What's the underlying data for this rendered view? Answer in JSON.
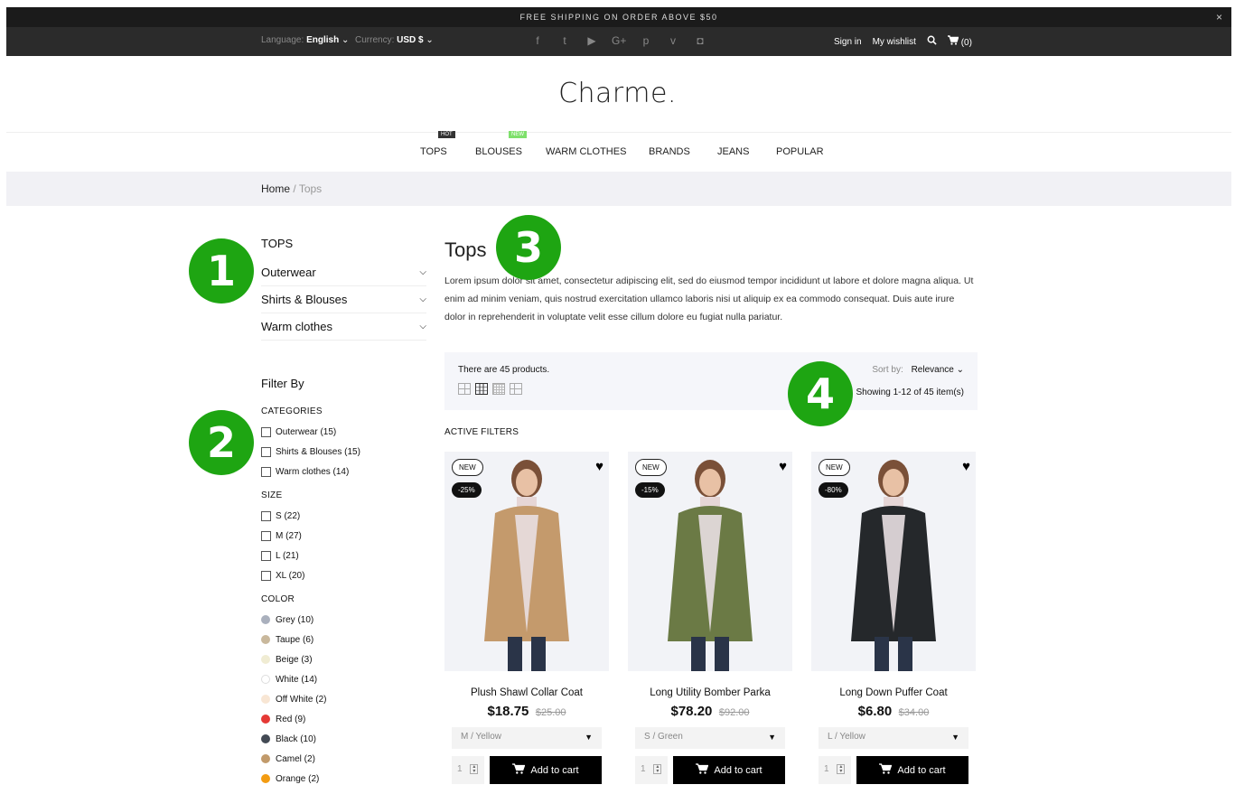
{
  "promo": {
    "text": "FREE SHIPPING ON ORDER ABOVE $50",
    "close": "×"
  },
  "topbar": {
    "language_label": "Language:",
    "language_value": "English",
    "currency_label": "Currency:",
    "currency_value": "USD $",
    "social": [
      "f",
      "t",
      "▶",
      "G+",
      "p",
      "v",
      "◘"
    ],
    "sign_in": "Sign in",
    "wishlist": "My wishlist",
    "cart_count": "(0)"
  },
  "logo": "Charme.",
  "nav": [
    {
      "label": "TOPS",
      "badge": "HOT",
      "badge_color": "#333333"
    },
    {
      "label": "BLOUSES",
      "badge": "NEW",
      "badge_color": "#7ee06b"
    },
    {
      "label": "WARM CLOTHES"
    },
    {
      "label": "BRANDS"
    },
    {
      "label": "JEANS"
    },
    {
      "label": "POPULAR"
    }
  ],
  "breadcrumb": {
    "home": "Home",
    "sep": "/",
    "current": "Tops"
  },
  "sidebar": {
    "title": "TOPS",
    "categories": [
      "Outerwear",
      "Shirts & Blouses",
      "Warm clothes"
    ],
    "filter_by": "Filter By",
    "groups": {
      "categories": {
        "title": "CATEGORIES",
        "items": [
          "Outerwear (15)",
          "Shirts & Blouses (15)",
          "Warm clothes (14)"
        ]
      },
      "size": {
        "title": "SIZE",
        "items": [
          "S (22)",
          "M (27)",
          "L (21)",
          "XL (20)"
        ]
      },
      "color": {
        "title": "COLOR",
        "items": [
          {
            "label": "Grey (10)",
            "color": "#aab0bd"
          },
          {
            "label": "Taupe (6)",
            "color": "#c9b89c"
          },
          {
            "label": "Beige (3)",
            "color": "#f0ecd3"
          },
          {
            "label": "White (14)",
            "color": "#ffffff"
          },
          {
            "label": "Off White (2)",
            "color": "#f8e6d4"
          },
          {
            "label": "Red (9)",
            "color": "#e53935"
          },
          {
            "label": "Black (10)",
            "color": "#434a54"
          },
          {
            "label": "Camel (2)",
            "color": "#c19a6b"
          },
          {
            "label": "Orange (2)",
            "color": "#f39c12"
          }
        ]
      }
    }
  },
  "main": {
    "title": "Tops",
    "description": "Lorem ipsum dolor sit amet, consectetur adipiscing elit, sed do eiusmod tempor incididunt ut labore et dolore magna aliqua. Ut enim ad minim veniam, quis nostrud exercitation ullamco laboris nisi ut aliquip ex ea commodo consequat. Duis aute irure dolor in reprehenderit in voluptate velit esse cillum dolore eu fugiat nulla pariatur.",
    "count_text": "There are 45 products.",
    "sort_label": "Sort by:",
    "sort_value": "Relevance",
    "showing": "Showing 1-12 of 45 item(s)",
    "active_filters": "ACTIVE FILTERS"
  },
  "products": [
    {
      "name": "Plush Shawl Collar Coat",
      "price": "$18.75",
      "old_price": "$25.00",
      "badge_new": "NEW",
      "discount": "-25%",
      "variant": "M / Yellow",
      "qty": "1",
      "coat": "#c49a6c",
      "cart": "Add to cart"
    },
    {
      "name": "Long Utility Bomber Parka",
      "price": "$78.20",
      "old_price": "$92.00",
      "badge_new": "NEW",
      "discount": "-15%",
      "variant": "S / Green",
      "qty": "1",
      "coat": "#6b7a45",
      "cart": "Add to cart"
    },
    {
      "name": "Long Down Puffer Coat",
      "price": "$6.80",
      "old_price": "$34.00",
      "badge_new": "NEW",
      "discount": "-80%",
      "variant": "L / Yellow",
      "qty": "1",
      "coat": "#25282b",
      "cart": "Add to cart"
    }
  ],
  "markers": [
    "1",
    "2",
    "3",
    "4"
  ]
}
